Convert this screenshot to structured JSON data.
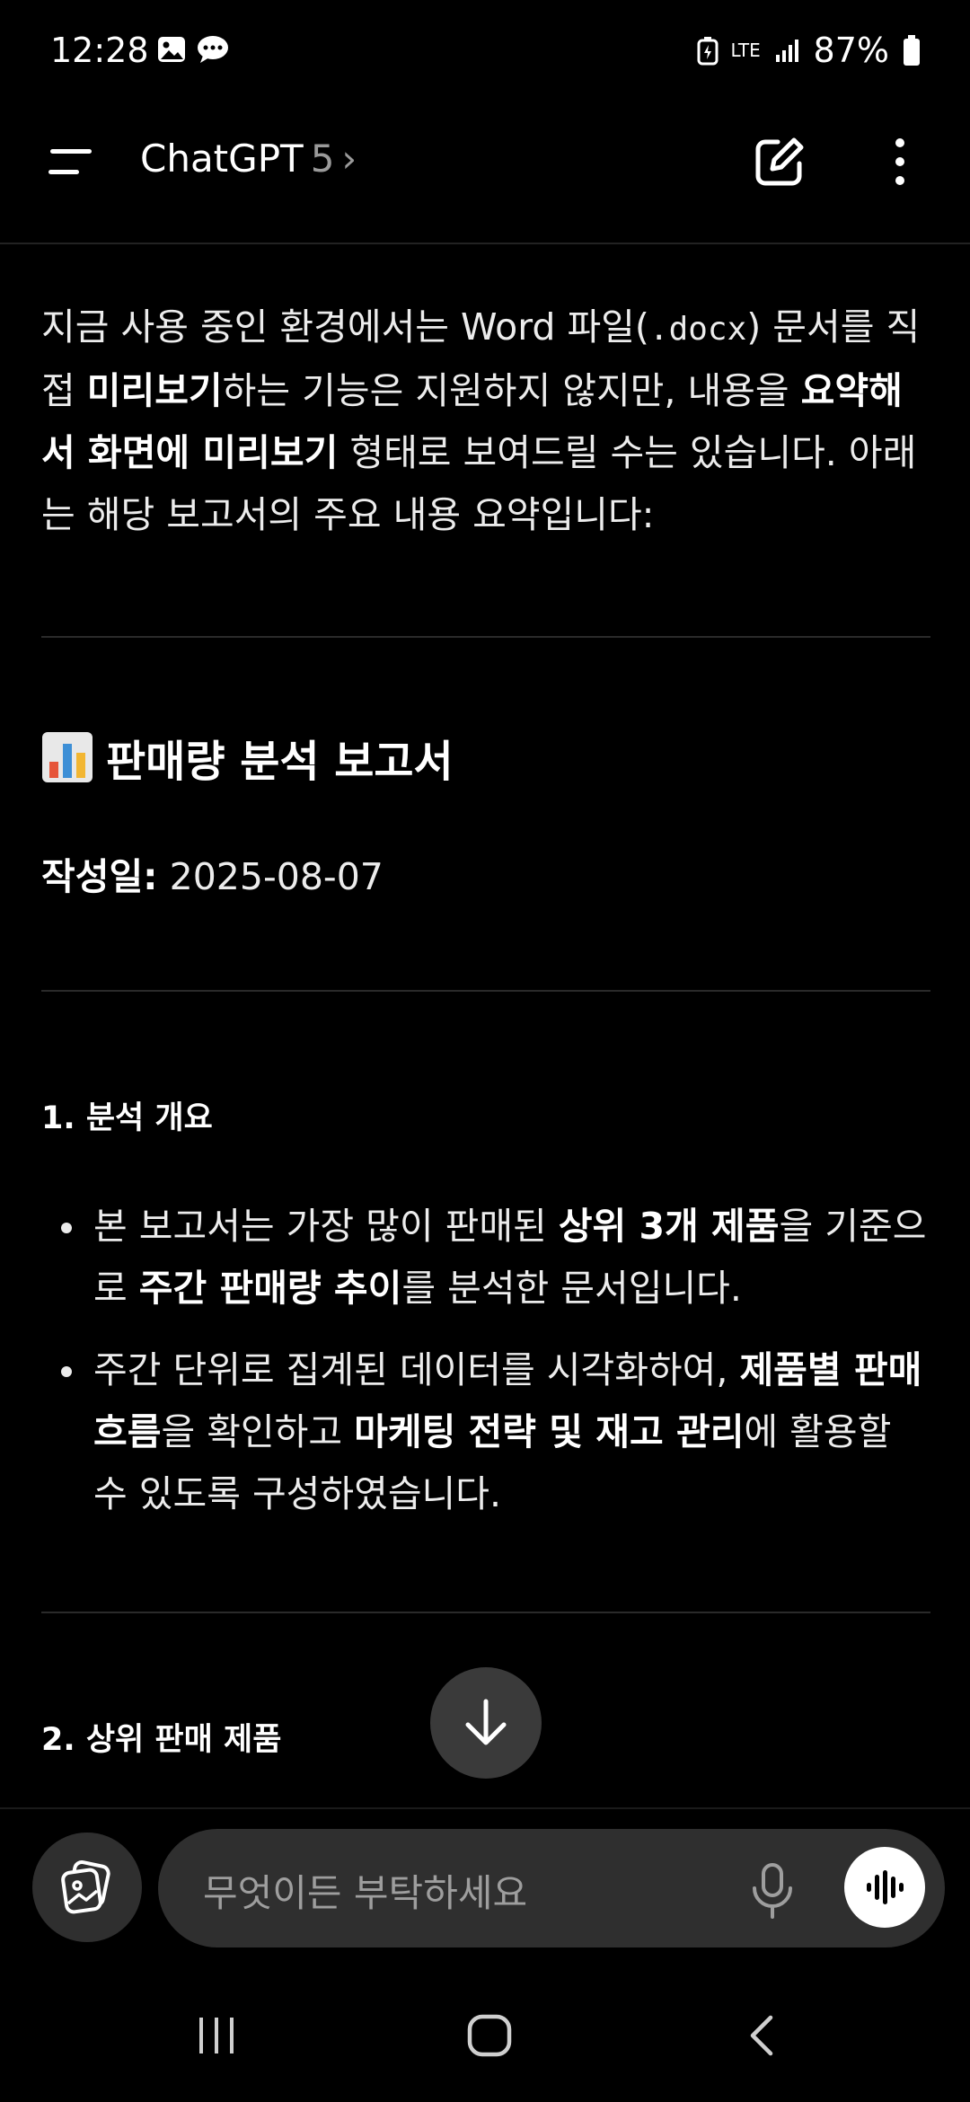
{
  "status_bar": {
    "time": "12:28",
    "network": "LTE",
    "battery": "87%"
  },
  "app_bar": {
    "title": "ChatGPT",
    "version": "5",
    "chevron": "›"
  },
  "message": {
    "intro_parts": [
      "지금 사용 중인 환경에서는 Word 파일(",
      ".docx",
      ") 문서를 직접 ",
      "미리보기",
      "하는 기능은 지원하지 않지만, 내용을 ",
      "요약해서 화면에 미리보기",
      " 형태로 보여드릴 수는 있습니다. 아래는 해당 보고서의 주요 내용 요약입니다:"
    ],
    "report_emoji": "📊",
    "report_title": "판매량 분석 보고서",
    "date_label": "작성일:",
    "date_value": "2025-08-07",
    "section1_title": "1. 분석 개요",
    "bullet1_parts": [
      "본 보고서는 가장 많이 판매된 ",
      "상위 3개 제품",
      "을 기준으로 ",
      "주간 판매량 추이",
      "를 분석한 문서입니다."
    ],
    "bullet2_parts": [
      "주간 단위로 집계된 데이터를 시각화하여, ",
      "제품별 판매 흐름",
      "을 확인하고 ",
      "마케팅 전략 및 재고 관리",
      "에 활용할 수 있도록 구성하였습니다."
    ],
    "section2_title": "2. 상위 판매 제품"
  },
  "composer": {
    "placeholder": "무엇이든 부탁하세요"
  },
  "icons": {
    "menu": "menu-icon",
    "new_chat": "edit-icon",
    "more": "more-vertical-icon",
    "scroll": "arrow-down-icon",
    "attach": "attach-image-icon",
    "mic": "mic-icon",
    "voice": "voice-waveform-icon"
  },
  "colors": {
    "background": "#000000",
    "surface": "#2f2f2f",
    "text": "#ececec",
    "muted": "#9e9e9e"
  }
}
